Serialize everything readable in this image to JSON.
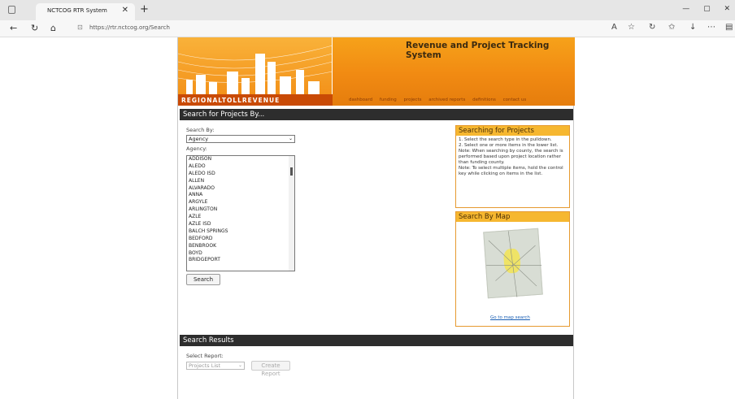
{
  "browser": {
    "tab_title": "NCTCOG RTR System",
    "tab_close": "✕",
    "new_tab": "+",
    "url": "https://rtr.nctcog.org/Search",
    "window_buttons": [
      "—",
      "▢",
      "✕"
    ]
  },
  "banner": {
    "title": "Revenue and Project Tracking System",
    "logo_text": "REGIONALTOLLREVENUE",
    "nav": [
      "dashboard",
      "funding",
      "projects",
      "archived reports",
      "definitions",
      "contact us"
    ]
  },
  "search": {
    "section_title": "Search for Projects By...",
    "search_by_label": "Search By:",
    "search_by_value": "Agency",
    "agency_label": "Agency:",
    "agencies": [
      "ADDISON",
      "ALEDO",
      "ALEDO ISD",
      "ALLEN",
      "ALVARADO",
      "ANNA",
      "ARGYLE",
      "ARLINGTON",
      "AZLE",
      "AZLE ISD",
      "BALCH SPRINGS",
      "BEDFORD",
      "BENBROOK",
      "BOYD",
      "BRIDGEPORT"
    ],
    "search_button": "Search"
  },
  "help_panel": {
    "title": "Searching for Projects",
    "lines": [
      "1. Select the search type in the pulldown.",
      "2. Select one or more items in the lower list.",
      "Note: When searching by county, the search is performed based upon project location rather than funding county.",
      "Note: To select multiple items, hold the control key while clicking on items in the list."
    ]
  },
  "map_panel": {
    "title": "Search By Map",
    "link": "Go to map search"
  },
  "results": {
    "section_title": "Search Results",
    "select_label": "Select Report:",
    "select_value": "Projects List",
    "create_button": "Create Report"
  }
}
